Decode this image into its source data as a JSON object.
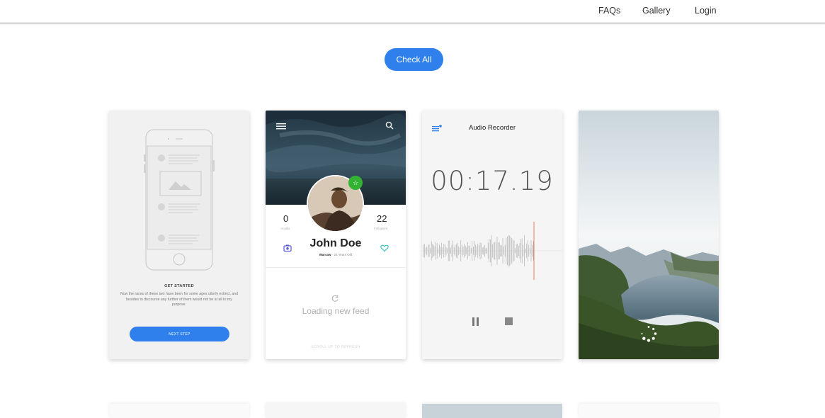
{
  "header": {
    "nav": [
      "FAQs",
      "Gallery",
      "Login"
    ]
  },
  "main": {
    "check_all_label": "Check All"
  },
  "cards": {
    "onboarding": {
      "title": "GET STARTED",
      "body": "Now the races of these two have been for some ages utterly extinct, and besides to discourse any further of them would not be at all to my purpose.",
      "button_label": "NEXT STEP"
    },
    "profile": {
      "left_stat_value": "0",
      "left_stat_label": "Anoiks",
      "right_stat_value": "22",
      "right_stat_label": "Followers",
      "name": "John Doe",
      "city": "Warsaw",
      "age": "25 Years Old",
      "loading_text": "Loading new feed",
      "scroll_hint": "SCROLL UP TO REFRESH"
    },
    "recorder": {
      "title": "Audio Recorder",
      "timer": "00:17.19"
    }
  },
  "colors": {
    "accent": "#2f80ed",
    "badge_green": "#34b233",
    "record_line": "#ef5b3d"
  },
  "icons": [
    "menu-icon",
    "search-icon",
    "star-icon",
    "camera-icon",
    "heart-icon",
    "refresh-icon",
    "list-icon",
    "pause-icon",
    "stop-icon",
    "spinner-icon"
  ]
}
